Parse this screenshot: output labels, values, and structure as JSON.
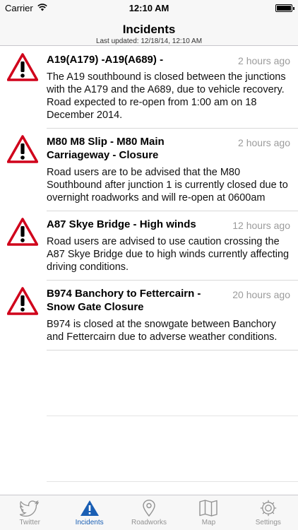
{
  "status_bar": {
    "carrier": "Carrier",
    "time": "12:10 AM"
  },
  "nav": {
    "title": "Incidents",
    "subtitle": "Last updated: 12/18/14, 12:10 AM"
  },
  "incidents": [
    {
      "title": "A19(A179) -A19(A689) -",
      "time": "2 hours ago",
      "body": "The A19 southbound is closed between the junctions with the A179 and the A689, due to vehicle recovery. Road expected to re-open from 1:00 am on 18 December 2014."
    },
    {
      "title": "M80 M8 Slip - M80 Main Carriageway - Closure",
      "time": "2 hours ago",
      "body": "Road users are to be advised that the M80 Southbound after junction 1 is currently closed due to overnight roadworks and will re-open at 0600am"
    },
    {
      "title": "A87 Skye Bridge - High winds",
      "time": "12 hours ago",
      "body": "Road users are advised to use caution crossing the A87 Skye Bridge due to high winds currently affecting driving conditions."
    },
    {
      "title": "B974 Banchory to Fettercairn - Snow Gate Closure",
      "time": "20 hours ago",
      "body": "B974 is closed at the snowgate between Banchory and Fettercairn due to adverse weather conditions."
    }
  ],
  "tabs": [
    {
      "label": "Twitter",
      "icon": "twitter-bird-icon",
      "active": false
    },
    {
      "label": "Incidents",
      "icon": "warning-triangle-icon",
      "active": true
    },
    {
      "label": "Roadworks",
      "icon": "map-pin-icon",
      "active": false
    },
    {
      "label": "Map",
      "icon": "folded-map-icon",
      "active": false
    },
    {
      "label": "Settings",
      "icon": "gear-icon",
      "active": false
    }
  ],
  "colors": {
    "warning_red": "#d0021b",
    "active_tab": "#1a5fb4",
    "inactive_tab": "#929292"
  }
}
